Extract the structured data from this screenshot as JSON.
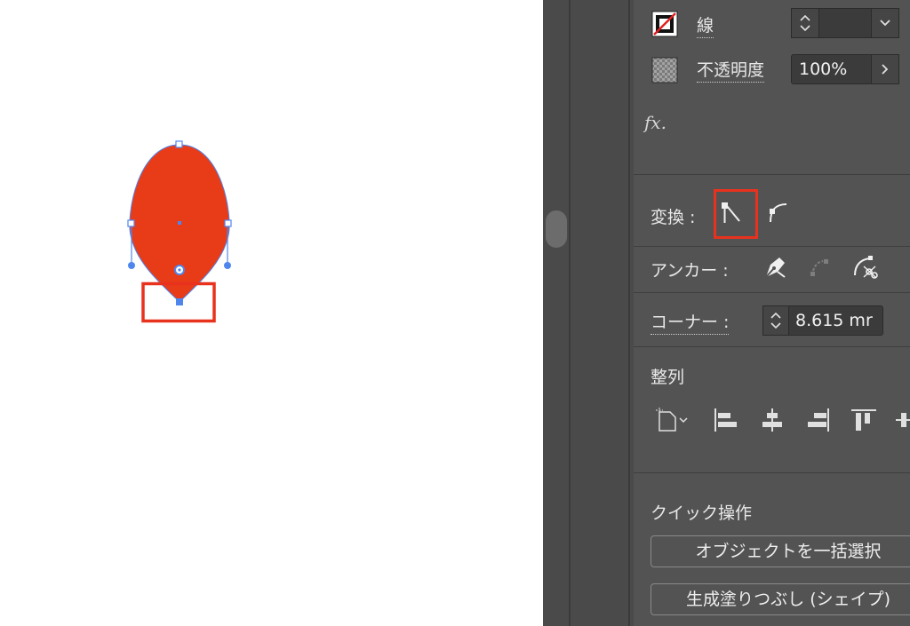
{
  "appearance": {
    "stroke_label": "線",
    "opacity_label": "不透明度",
    "opacity_value": "100%",
    "fx_label": "fx."
  },
  "transform": {
    "label": "変換 :"
  },
  "anchor": {
    "label": "アンカー :"
  },
  "corner": {
    "label": "コーナー :",
    "value": "8.615 mr"
  },
  "align": {
    "label": "整列"
  },
  "quick_actions": {
    "label": "クイック操作",
    "select_same_button": "オブジェクトを一括選択",
    "generative_fill_button": "生成塗りつぶし (シェイプ)"
  },
  "colors": {
    "shape_fill": "#e83b18",
    "selection_blue": "#4f86ee",
    "highlight_red": "#e8321e",
    "panel_bg": "#535353"
  }
}
